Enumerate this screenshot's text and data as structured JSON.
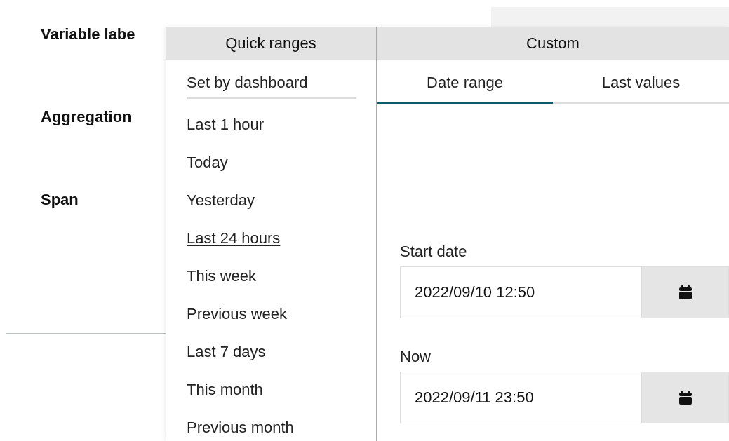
{
  "form": {
    "labels": [
      "Variable labe",
      "Aggregation",
      "Span"
    ]
  },
  "popup": {
    "quick_ranges": {
      "title": "Quick ranges",
      "default_item": {
        "label": "Set by dashboard",
        "selected": false
      },
      "items": [
        {
          "label": "Last 1 hour",
          "selected": false
        },
        {
          "label": "Today",
          "selected": false
        },
        {
          "label": "Yesterday",
          "selected": false
        },
        {
          "label": "Last 24 hours",
          "selected": true
        },
        {
          "label": "This week",
          "selected": false
        },
        {
          "label": "Previous week",
          "selected": false
        },
        {
          "label": "Last 7 days",
          "selected": false
        },
        {
          "label": "This month",
          "selected": false
        },
        {
          "label": "Previous month",
          "selected": false
        }
      ]
    },
    "custom": {
      "title": "Custom",
      "tabs": [
        {
          "label": "Date range",
          "selected": true
        },
        {
          "label": "Last values",
          "selected": false
        }
      ],
      "fields": [
        {
          "label": "Start date",
          "value": "2022/09/10 12:50"
        },
        {
          "label": "Now",
          "value": "2022/09/11 23:50"
        }
      ]
    }
  }
}
